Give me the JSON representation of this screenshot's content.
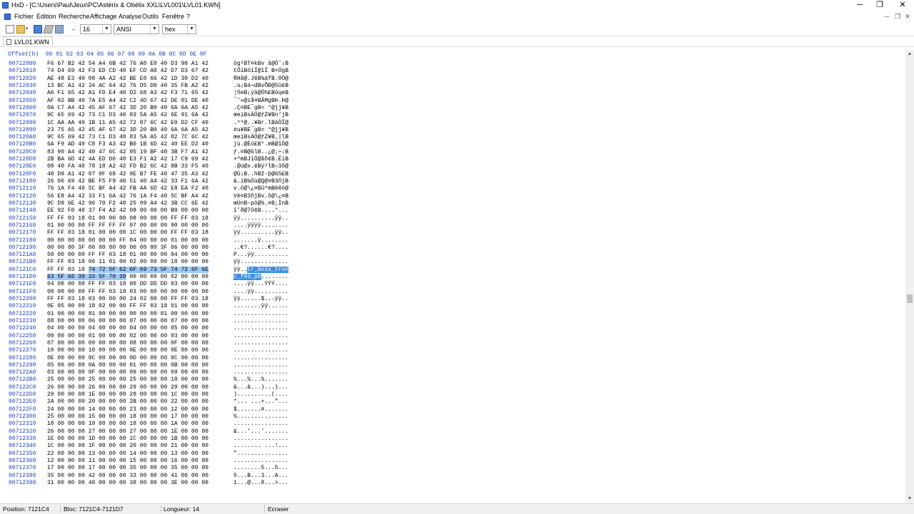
{
  "window": {
    "title": "HxD - [C:\\Users\\Paul\\Jeux\\PC\\Astérix & Obélix XXL\\LVL001\\LVL01.KWN]",
    "minimize": "─",
    "maximize": "❐",
    "close": "✕"
  },
  "menu": {
    "items": [
      "Fichier",
      "Edition",
      "Recherche",
      "Affichage",
      "Analyse",
      "Outils",
      "Fenêtre",
      "?"
    ]
  },
  "toolbar": {
    "bytes_per_row": "16",
    "charset": "ANSI",
    "offset_base": "hex"
  },
  "tab": {
    "label": "LVL01.KWN"
  },
  "editor": {
    "offset_header": "Offset(h)",
    "column_header": "00 01 02 03 04 05 06 07 08 09 0A 0B 0C 0D 0E 0F",
    "selection": {
      "start_offset": "007121C4",
      "end_offset": "007121D7"
    },
    "rows": [
      {
        "off": "00712000",
        "hex": "F6 67 B2 42 54 A4 6B 42 76 A0 E0 40 D3 98 A1 42",
        "txt": "ög²BT¤kBv à@Ó˜¡B"
      },
      {
        "off": "00712010",
        "hex": "74 D4 69 42 F3 ED CD 40 EF CD A0 42 D7 D3 67 42",
        "txt": "tÔiBóíÍ@ïÍ B×ÓgB"
      },
      {
        "off": "00712020",
        "hex": "AE 48 E3 40 08 4A A2 42 BE E0 66 42 1D 30 D2 40",
        "txt": "®Hã@.J¢B¾àfB.0Ò@"
      },
      {
        "off": "00712030",
        "hex": "13 BC A1 42 34 AC 64 42 76 D5 D0 40 35 FB A2 42",
        "txt": ".¼¡B4¬dBvÕÐ@5û¢B"
      },
      {
        "off": "00712040",
        "hex": "A6 F1 65 42 A1 FD E4 40 D2 68 A3 42 F3 71 65 42",
        "txt": "¦ñeB¡ýä@Òh£BóqeB"
      },
      {
        "off": "00712050",
        "hex": "AF 92 BB 40 7A E5 A4 42 C2 4D 67 42 DE 01 DE 40",
        "txt": "¯’»@zå¤BÂMgBÞ.Þ@"
      },
      {
        "off": "00712060",
        "hex": "0A C7 A4 42 45 AF 67 42 3D 20 B0 40 6A 6A A5 42",
        "txt": ".Ç¤BE¯gB= °@jj¥B"
      },
      {
        "off": "00712070",
        "hex": "9C 65 69 42 73 C1 D3 40 83 5A A5 42 6E 91 6A 42",
        "txt": "œeiBsÁÓ@ƒZ¥Bn‘jB"
      },
      {
        "off": "00712080",
        "hex": "1C AA AA 40 1B 11 A5 42 72 07 6C 42 E0 D2 CF 40",
        "txt": ".ªª@..¥Br.lBàÒÏ@"
      },
      {
        "off": "00712090",
        "hex": "23 75 A5 42 45 AF 67 42 3D 20 B0 40 6A 6A A5 42",
        "txt": "#u¥BE¯gB= °@jj¥B"
      },
      {
        "off": "007120A0",
        "hex": "9C 65 69 42 73 C1 D3 40 83 5A A5 42 82 7C 6C 42",
        "txt": "œeiBsÁÓ@ƒZ¥B‚|lB"
      },
      {
        "off": "007120B0",
        "hex": "6A F9 AD 40 C8 F3 A3 42 B0 1B 6D 42 40 EE D2 40",
        "txt": "jù.@Èó£B°.mB@îÒ@"
      },
      {
        "off": "007120C0",
        "hex": "83 90 A4 42 40 47 6C 42 05 19 BF 40 3B F7 A1 42",
        "txt": "ƒ.¤B@GlB..¿@;÷¡B"
      },
      {
        "off": "007120D0",
        "hex": "2B BA 6D 42 4A ED D6 40 E3 F1 A2 42 17 C9 69 42",
        "txt": "+ºmBJíÖ@ãñ¢B.ÉiB"
      },
      {
        "off": "007120E0",
        "hex": "08 40 FA 40 78 18 A2 42 FD B2 6C 42 8B 33 F5 40",
        "txt": ".@ú@x.¢Bý²lB‹3õ@"
      },
      {
        "off": "007120F0",
        "hex": "40 D9 A1 42 07 0F 68 42 9E B7 FE 40 47 35 A3 42",
        "txt": "@Ù¡B..hBž·þ@G5£B"
      },
      {
        "off": "00712100",
        "hex": "26 06 69 42 BE F5 F9 40 51 40 A4 42 33 F1 6A 42",
        "txt": "&.iB¾õù@Q@¤B3ñjB"
      },
      {
        "off": "00712110",
        "hex": "76 1A F4 40 5C BF A4 42 FB AA 6D 42 E8 EA F2 40",
        "txt": "v.ô@\\¿¤BûªmBèêò@"
      },
      {
        "off": "00712120",
        "hex": "56 E8 A4 42 33 F1 6A 42 76 1A F4 40 5C BF A4 42",
        "txt": "Vè¤B3ñjBv.ô@\\¿¤B"
      },
      {
        "off": "00712130",
        "hex": "9C D9 6E 42 96 70 F2 40 25 09 A4 42 3B CC 6E 42",
        "txt": "œÙnB–pò@%.¤B;ÌnB"
      },
      {
        "off": "00712140",
        "hex": "EE 92 F0 40 37 F4 A2 42 08 00 00 00 B0 00 00 00",
        "txt": "î’ð@7ô¢B....°..."
      },
      {
        "off": "00712150",
        "hex": "FF FF 03 18 01 00 00 00 08 00 00 00 FF FF 03 18",
        "txt": "ÿÿ..........ÿÿ.."
      },
      {
        "off": "00712160",
        "hex": "01 00 00 00 FF FF FF FF 07 00 00 00 90 00 00 00",
        "txt": "....ÿÿÿÿ........"
      },
      {
        "off": "00712170",
        "hex": "FF FF 03 18 01 00 00 00 1C 00 00 00 FF FF 03 18",
        "txt": "ÿÿ..........ÿÿ.."
      },
      {
        "off": "00712180",
        "hex": "00 00 00 00 00 00 00 FF 04 00 00 00 01 00 00 00",
        "txt": ".......ÿ........"
      },
      {
        "off": "00712190",
        "hex": "00 00 80 3F 00 00 00 00 00 00 80 3F 06 00 00 00",
        "txt": "..€?......€?...."
      },
      {
        "off": "007121A0",
        "hex": "50 00 00 00 FF FF 03 18 01 00 00 00 04 00 00 00",
        "txt": "P...ÿÿ.........."
      },
      {
        "off": "007121B0",
        "hex": "FF FF 03 18 06 11 01 00 02 00 00 00 18 00 00 00",
        "txt": "ÿÿ.............."
      },
      {
        "off": "007121C0",
        "hex": "FF FF 03 18 74 72 5F 62 6F 69 73 5F 74 72 6F 6E",
        "txt": "ÿÿ..tr_bois_tron"
      },
      {
        "off": "007121D0",
        "hex": "63 5F 66 30 33 5F 70 30 00 00 00 00 02 00 00 00",
        "txt": "c_f03_p0........"
      },
      {
        "off": "007121E0",
        "hex": "04 00 00 00 FF FF 03 18 00 DD DD DD 03 00 00 00",
        "txt": "....ÿÿ...ÝÝÝ...."
      },
      {
        "off": "007121F0",
        "hex": "00 00 00 00 FF FF 03 18 03 00 00 00 00 00 00 00",
        "txt": "....ÿÿ.........."
      },
      {
        "off": "00712200",
        "hex": "FF FF 03 18 03 00 00 00 24 02 00 00 FF FF 03 18",
        "txt": "ÿÿ......$...ÿÿ.."
      },
      {
        "off": "00712210",
        "hex": "0E 05 00 00 18 02 00 00 FF FF 03 18 01 00 00 00",
        "txt": "........ÿÿ......"
      },
      {
        "off": "00712220",
        "hex": "01 00 00 00 81 00 00 00 00 00 00 81 00 00 00 00",
        "txt": "................"
      },
      {
        "off": "00712230",
        "hex": "08 00 00 00 06 00 00 00 07 00 00 00 07 00 00 00",
        "txt": "................"
      },
      {
        "off": "00712240",
        "hex": "04 00 00 00 04 00 00 00 04 00 00 00 05 00 00 00",
        "txt": "................"
      },
      {
        "off": "00712250",
        "hex": "00 00 00 00 01 00 00 00 02 00 00 00 03 00 00 00",
        "txt": "................"
      },
      {
        "off": "00712260",
        "hex": "07 00 00 00 09 00 00 00 08 00 00 00 0F 00 00 00",
        "txt": "................"
      },
      {
        "off": "00712270",
        "hex": "10 00 00 00 10 00 00 00 0E 00 00 00 0E 00 00 00",
        "txt": "................"
      },
      {
        "off": "00712280",
        "hex": "0E 00 00 00 0C 00 00 00 0D 00 00 00 0C 00 00 00",
        "txt": "................"
      },
      {
        "off": "00712290",
        "hex": "05 00 00 00 0A 00 00 00 01 00 00 00 0B 00 00 00",
        "txt": "................"
      },
      {
        "off": "007122A0",
        "hex": "03 00 00 00 0F 00 00 00 09 00 00 00 09 00 00 00",
        "txt": "................"
      },
      {
        "off": "007122B0",
        "hex": "25 00 00 00 25 00 00 00 25 00 00 00 18 00 00 00",
        "txt": "%...%...%......."
      },
      {
        "off": "007122C0",
        "hex": "26 00 00 00 26 00 00 00 29 00 00 00 29 00 00 00",
        "txt": "&...&...)...)..."
      },
      {
        "off": "007122D0",
        "hex": "29 00 00 00 1E 00 00 00 28 00 00 00 1C 00 00 00",
        "txt": ")..........(...."
      },
      {
        "off": "007122E0",
        "hex": "2A 00 00 00 20 00 00 00 2B 00 00 00 22 00 00 00",
        "txt": "*... ...+...\"..."
      },
      {
        "off": "007122F0",
        "hex": "24 00 00 00 14 00 00 00 23 00 00 00 12 00 00 00",
        "txt": "$.......#......."
      },
      {
        "off": "00712300",
        "hex": "25 00 00 00 15 00 00 00 18 00 00 00 17 00 00 00",
        "txt": "%..............."
      },
      {
        "off": "00712310",
        "hex": "18 00 00 00 19 00 00 00 18 00 00 00 1A 00 00 00",
        "txt": "................"
      },
      {
        "off": "00712320",
        "hex": "26 00 00 00 27 00 00 00 27 00 00 00 1E 00 00 00",
        "txt": "&...'...'......."
      },
      {
        "off": "00712330",
        "hex": "1E 00 00 00 1D 00 00 00 1C 00 00 00 1B 00 00 00",
        "txt": "................"
      },
      {
        "off": "00712340",
        "hex": "1C 00 00 00 1F 00 00 00 20 00 00 00 21 00 00 00",
        "txt": "........ ...!..."
      },
      {
        "off": "00712350",
        "hex": "22 00 00 00 13 00 00 00 14 00 00 00 13 00 00 00",
        "txt": "\"..............."
      },
      {
        "off": "00712360",
        "hex": "12 00 00 00 11 00 00 00 15 00 00 00 16 00 00 00",
        "txt": "................"
      },
      {
        "off": "00712370",
        "hex": "17 00 00 00 17 00 00 00 35 00 00 00 35 00 00 00",
        "txt": "........5...5..."
      },
      {
        "off": "00712380",
        "hex": "35 00 00 00 42 00 00 00 33 00 00 00 41 00 00 00",
        "txt": "5...B...3...A..."
      },
      {
        "off": "00712390",
        "hex": "31 00 00 00 40 00 00 00 38 00 00 00 3E 00 00 00",
        "txt": "1...@...8...>..."
      }
    ]
  },
  "status": {
    "position": "Position: 7121C4",
    "block": "Bloc: 7121C4-7121D7",
    "length": "Longueur: 14",
    "mode": "Ecraser"
  },
  "colors": {
    "offset_blue": "#1b3fc4",
    "selection": "#9fc9f5",
    "selection_strong": "#3d8ee0"
  }
}
